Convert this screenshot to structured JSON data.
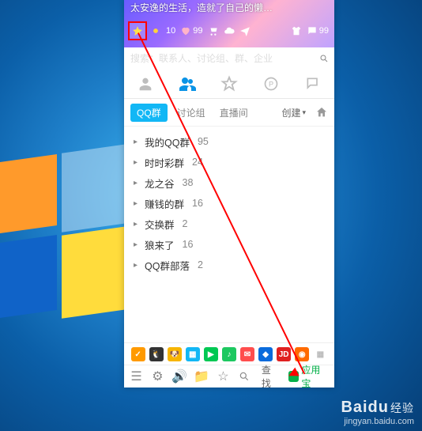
{
  "header": {
    "status_text": "太安逸的生活，造就了自己的懒…",
    "vip_level": "10",
    "credit": "99",
    "msg_count": "99"
  },
  "search": {
    "placeholder": "搜索：联系人、讨论组、群、企业"
  },
  "sub_tabs": {
    "active": "QQ群",
    "t1": "讨论组",
    "t2": "直播间",
    "create": "创建"
  },
  "groups": [
    {
      "name": "我的QQ群",
      "count": "95"
    },
    {
      "name": "时时彩群",
      "count": "24"
    },
    {
      "name": "龙之谷",
      "count": "38"
    },
    {
      "name": "赚钱的群",
      "count": "16"
    },
    {
      "name": "交换群",
      "count": "2"
    },
    {
      "name": "狼来了",
      "count": "16"
    },
    {
      "name": "QQ群部落",
      "count": "2"
    }
  ],
  "apps": {
    "jd": "JD"
  },
  "bottom": {
    "find_label": "查找",
    "appstore_label": "应用宝"
  },
  "watermark": {
    "brand": "Baidu",
    "sub": "经验",
    "url": "jingyan.baidu.com"
  }
}
